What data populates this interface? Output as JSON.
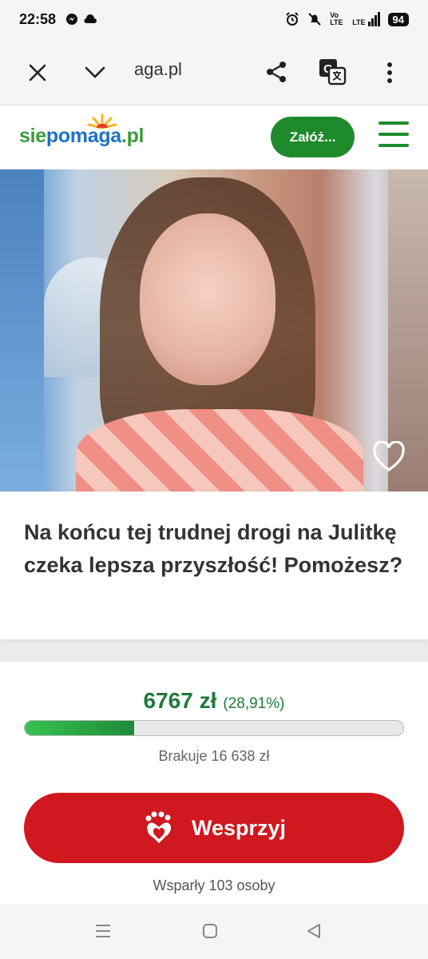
{
  "status_bar": {
    "time": "22:58",
    "network": "LTE",
    "volte": "Vo LTE",
    "battery": "94"
  },
  "browser": {
    "url": "aga.pl",
    "icons": [
      "close-icon",
      "chevron-down-icon",
      "share-icon",
      "translate-icon",
      "more-vert-icon"
    ]
  },
  "site": {
    "logo": {
      "part1": "sie",
      "part2": "pomaga",
      "part3": ".pl"
    },
    "cta_label": "Załóż...",
    "brand_green": "#1f8a2c",
    "brand_red": "#d0181f"
  },
  "campaign": {
    "title": "Na końcu tej trudnej drogi na Julitkę czeka lepsza przyszłość! Pomożesz?",
    "amount": "6767 zł",
    "percent_label": "(28,91%)",
    "progress": 0.2891,
    "missing": "Brakuje 16 638 zł",
    "donate_label": "Wesprzyj",
    "supporters": "Wsparły 103 osoby"
  },
  "nav": {
    "icons": [
      "menu-icon",
      "home-icon",
      "back-icon"
    ]
  }
}
